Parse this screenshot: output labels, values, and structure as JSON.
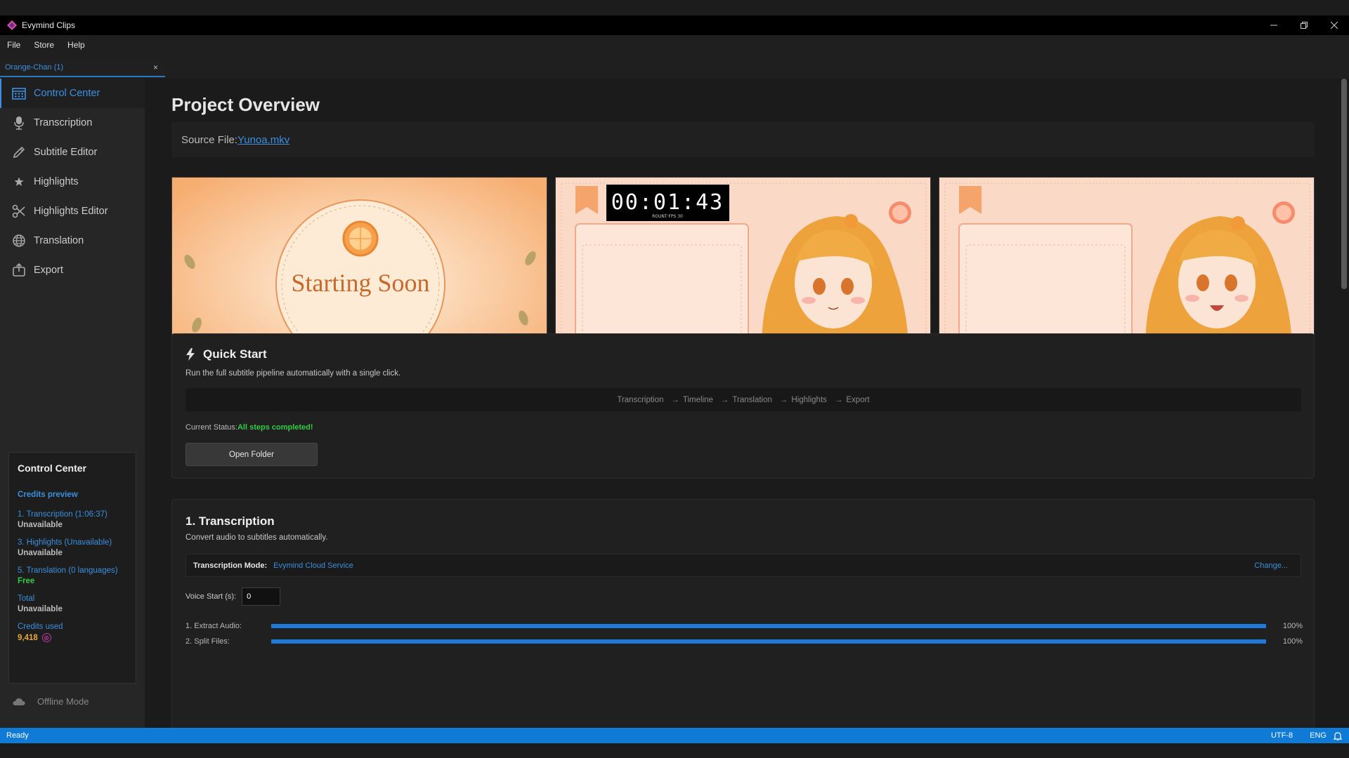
{
  "window": {
    "title": "Evymind Clips",
    "minimize_icon": "minimize-icon",
    "restore_icon": "restore-icon",
    "close_icon": "close-icon"
  },
  "menu": [
    "File",
    "Store",
    "Help"
  ],
  "doc_tab": {
    "label": "Orange-Chan (1)",
    "close": "×"
  },
  "sidebar": {
    "items": [
      {
        "label": "Control Center",
        "icon": "calendar-icon",
        "active": true
      },
      {
        "label": "Transcription",
        "icon": "microphone-icon"
      },
      {
        "label": "Subtitle Editor",
        "icon": "pencil-icon"
      },
      {
        "label": "Highlights",
        "icon": "star-icon"
      },
      {
        "label": "Highlights Editor",
        "icon": "scissors-icon"
      },
      {
        "label": "Translation",
        "icon": "globe-icon"
      },
      {
        "label": "Export",
        "icon": "export-icon"
      }
    ],
    "control_center": {
      "title": "Control Center",
      "heading": "Credits preview",
      "rows": [
        {
          "label": "1. Transcription (1:06:37)",
          "value": "Unavailable"
        },
        {
          "label": "3. Highlights (Unavailable)",
          "value": "Unavailable"
        },
        {
          "label": "5. Translation (0 languages)",
          "value": "Free"
        },
        {
          "label": "Total",
          "value": "Unavailable"
        }
      ],
      "credits_label": "Credits used",
      "credits_value": "9,418"
    },
    "offline_label": "Offline Mode"
  },
  "main": {
    "title": "Project Overview",
    "source_label": "Source File:",
    "source_file": "Yunoa.mkv",
    "thumbnails": [
      {
        "text": "Starting Soon"
      },
      {
        "timer": "00:01:43",
        "timer_sub": "ROUNT·FPS 30"
      },
      {}
    ],
    "quick_start": {
      "title": "Quick Start",
      "subtitle": "Run the full subtitle pipeline automatically with a single click.",
      "steps": [
        "Transcription",
        "Timeline",
        "Translation",
        "Highlights",
        "Export"
      ],
      "arrow": "→",
      "status_label": "Current Status:",
      "status_value": "All steps completed!",
      "open_folder": "Open Folder"
    },
    "transcription": {
      "title": "1. Transcription",
      "subtitle": "Convert audio to subtitles automatically.",
      "mode_label": "Transcription Mode:",
      "mode_value": "Evymind Cloud Service",
      "change": "Change...",
      "voice_start_label": "Voice Start (s):",
      "voice_start_value": "0",
      "progress": [
        {
          "label": "1. Extract Audio:",
          "value": 100,
          "pct": "100%"
        },
        {
          "label": "2. Split Files:",
          "value": 100,
          "pct": "100%"
        }
      ]
    }
  },
  "statusbar": {
    "left": "Ready",
    "encoding": "UTF-8",
    "lang": "ENG",
    "bell_icon": "bell-icon"
  },
  "colors": {
    "accent": "#3c8fdd",
    "statusbar": "#0f7bd6",
    "success": "#33cc44",
    "credits": "#e8a73c"
  }
}
